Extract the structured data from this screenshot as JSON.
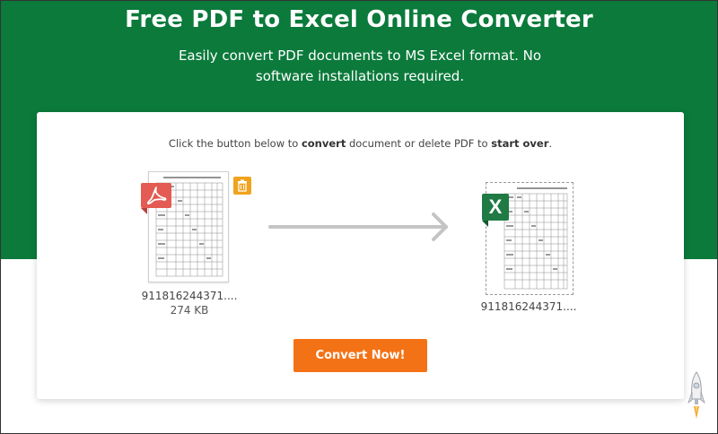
{
  "header": {
    "title": "Free PDF to Excel Online Converter",
    "subtitle": "Easily convert PDF documents to MS Excel format. No software installations required."
  },
  "card": {
    "instruction_parts": [
      "Click the button below to ",
      "convert",
      " document or delete PDF to ",
      "start over",
      "."
    ],
    "source_file": {
      "name": "911816244371....",
      "size": "274 KB",
      "icon": "pdf-icon"
    },
    "output_file": {
      "name": "911816244371....",
      "icon": "excel-icon",
      "badge_letter": "X"
    },
    "delete_icon": "trash-icon",
    "convert_label": "Convert Now!"
  },
  "colors": {
    "brand_green": "#0b7a3b",
    "button_orange": "#f47216",
    "pdf_red": "#e35b52",
    "excel_green": "#1f7a43",
    "trash_orange": "#f0a31e"
  }
}
